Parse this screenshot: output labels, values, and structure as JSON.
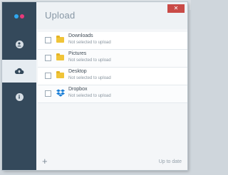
{
  "window": {
    "title": "Upload",
    "minimize_glyph": "–",
    "maximize_glyph": "□",
    "close_glyph": "✕"
  },
  "sidebar": {
    "logo_colors": [
      "#2fa8f0",
      "#e8397a"
    ],
    "items": [
      {
        "icon": "person-icon",
        "active": false
      },
      {
        "icon": "cloud-upload-icon",
        "active": true
      },
      {
        "icon": "info-icon",
        "active": false
      }
    ]
  },
  "items": [
    {
      "name": "Downloads",
      "status": "Not selected to upload",
      "icon": "folder-icon",
      "checked": false
    },
    {
      "name": "Pictures",
      "status": "Not selected to upload",
      "icon": "folder-icon",
      "checked": false
    },
    {
      "name": "Desktop",
      "status": "Not selected to upload",
      "icon": "folder-icon",
      "checked": false
    },
    {
      "name": "Dropbox",
      "status": "Not selected to upload",
      "icon": "dropbox-icon",
      "checked": false
    }
  ],
  "footer": {
    "add_label": "+",
    "status": "Up to date"
  },
  "colors": {
    "sidebar": "#34495b",
    "close": "#c94b47",
    "folder": "#f0c438",
    "dropbox": "#1a7ed6"
  }
}
